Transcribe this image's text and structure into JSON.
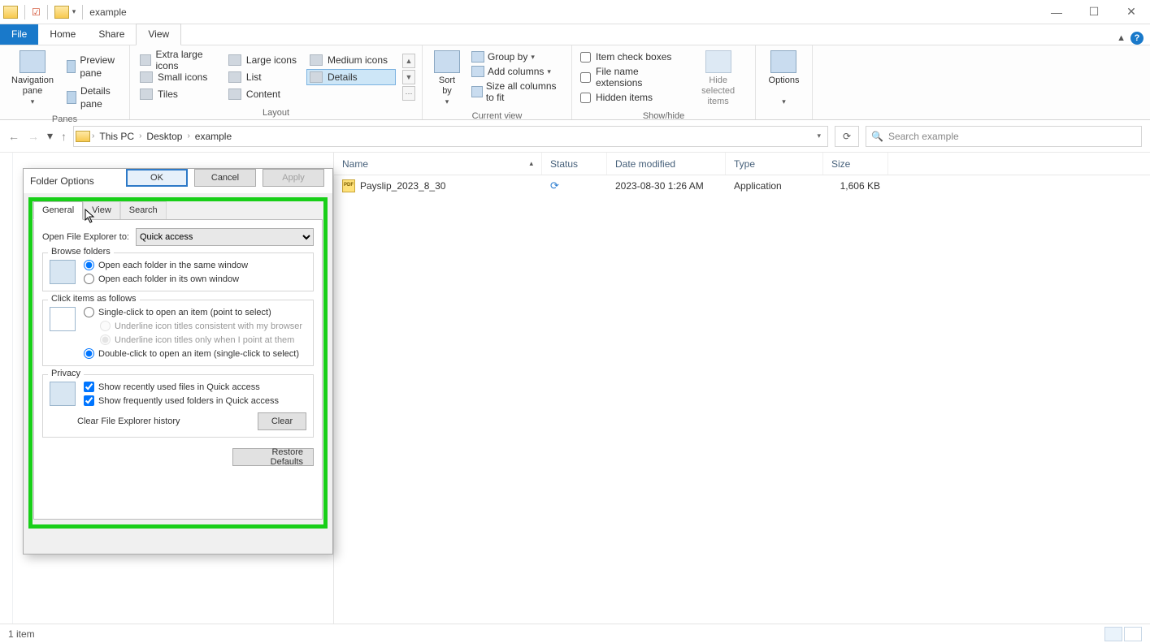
{
  "window": {
    "title": "example"
  },
  "menu": {
    "file": "File",
    "home": "Home",
    "share": "Share",
    "view": "View"
  },
  "ribbon": {
    "panes": {
      "navigation": "Navigation\npane",
      "preview": "Preview pane",
      "details": "Details pane",
      "group": "Panes"
    },
    "layout": {
      "xl": "Extra large icons",
      "large": "Large icons",
      "medium": "Medium icons",
      "small": "Small icons",
      "list": "List",
      "details": "Details",
      "tiles": "Tiles",
      "content": "Content",
      "group": "Layout"
    },
    "currentview": {
      "sort": "Sort\nby",
      "group_by": "Group by",
      "add_cols": "Add columns",
      "size_cols": "Size all columns to fit",
      "group": "Current view"
    },
    "showhide": {
      "item_check": "Item check boxes",
      "ext": "File name extensions",
      "hidden": "Hidden items",
      "hide_sel": "Hide selected\nitems",
      "group": "Show/hide"
    },
    "options": "Options"
  },
  "breadcrumb": {
    "thispc": "This PC",
    "desktop": "Desktop",
    "folder": "example"
  },
  "search": {
    "placeholder": "Search example"
  },
  "columns": {
    "name": "Name",
    "status": "Status",
    "date": "Date modified",
    "type": "Type",
    "size": "Size"
  },
  "files": [
    {
      "name": "Payslip_2023_8_30",
      "date": "2023-08-30 1:26 AM",
      "type": "Application",
      "size": "1,606 KB"
    }
  ],
  "status": {
    "items": "1 item"
  },
  "dialog": {
    "title": "Folder Options",
    "tabs": {
      "general": "General",
      "view": "View",
      "search": "Search"
    },
    "open_label": "Open File Explorer to:",
    "open_value": "Quick access",
    "browse": {
      "legend": "Browse folders",
      "same": "Open each folder in the same window",
      "own": "Open each folder in its own window"
    },
    "click": {
      "legend": "Click items as follows",
      "single": "Single-click to open an item (point to select)",
      "under_browser": "Underline icon titles consistent with my browser",
      "under_point": "Underline icon titles only when I point at them",
      "double": "Double-click to open an item (single-click to select)"
    },
    "privacy": {
      "legend": "Privacy",
      "recent": "Show recently used files in Quick access",
      "frequent": "Show frequently used folders in Quick access",
      "clear_label": "Clear File Explorer history",
      "clear_btn": "Clear"
    },
    "restore": "Restore Defaults",
    "ok": "OK",
    "cancel": "Cancel",
    "apply": "Apply"
  }
}
